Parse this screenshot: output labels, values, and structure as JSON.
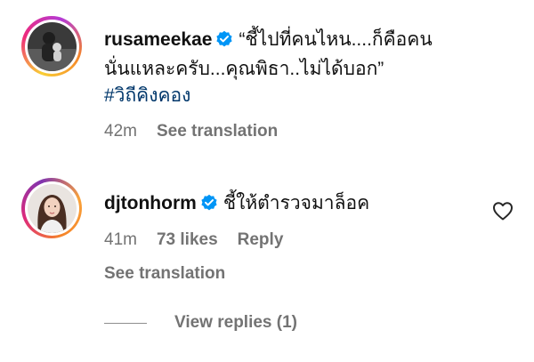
{
  "comments": [
    {
      "username": "rusameekae",
      "text_line1": "“ชี้ไปที่คนไหน....ก็คือคน",
      "text_line2": "นั่นแหละครับ...คุณพิธา..ไม่ได้บอก”",
      "hashtag": "#วิถีคิงคอง",
      "time": "42m",
      "see_translation": "See translation"
    },
    {
      "username": "djtonhorm",
      "text": "ชี้ให้ตำรวจมาล็อค",
      "time": "41m",
      "likes": "73 likes",
      "reply": "Reply",
      "see_translation": "See translation"
    }
  ],
  "view_replies": "View replies (1)",
  "icons": {
    "verified": "verified-badge-icon",
    "like": "heart-icon"
  },
  "colors": {
    "verified_blue": "#0095f6",
    "hashtag": "#00376b",
    "secondary_text": "#737373"
  }
}
